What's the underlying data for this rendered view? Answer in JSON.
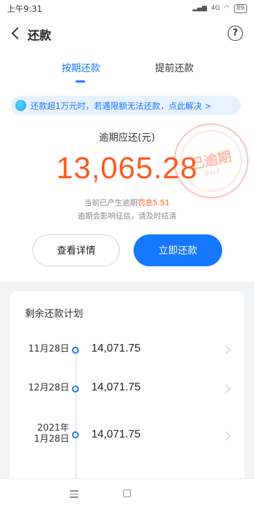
{
  "status_bar": {
    "time": "上午9:31",
    "network": "4G",
    "battery": "89"
  },
  "header": {
    "title": "还款"
  },
  "tabs": [
    {
      "label": "按期还款",
      "active": true
    },
    {
      "label": "提前还款",
      "active": false
    }
  ],
  "notice": {
    "text": "还款超1万元时，若遇限额无法还款，点此解决 >"
  },
  "overdue": {
    "label": "逾期应还(元)",
    "amount": "13,065.28",
    "penalty_prefix": "当前已产生逾期",
    "penalty_label": "罚息",
    "penalty_value": "5.51",
    "warning": "逾期会影响征信，请及时结清",
    "stamp_text": "已逾期",
    "stamp_sub": "DUE"
  },
  "buttons": {
    "detail": "查看详情",
    "repay": "立即还款"
  },
  "plan": {
    "title": "剩余还款计划",
    "rows": [
      {
        "date_line1": "11月28日",
        "date_line2": "",
        "amount": "14,071.75"
      },
      {
        "date_line1": "12月28日",
        "date_line2": "",
        "amount": "14,071.75"
      },
      {
        "date_line1": "2021年",
        "date_line2": "1月28日",
        "amount": "14,071.75"
      }
    ]
  },
  "colors": {
    "accent": "#1677ff",
    "overdue": "#ff5a1f"
  },
  "icons": [
    "back-arrow-icon",
    "help-icon",
    "notice-icon",
    "chevron-right-icon",
    "nav-menu-icon",
    "nav-home-icon"
  ]
}
